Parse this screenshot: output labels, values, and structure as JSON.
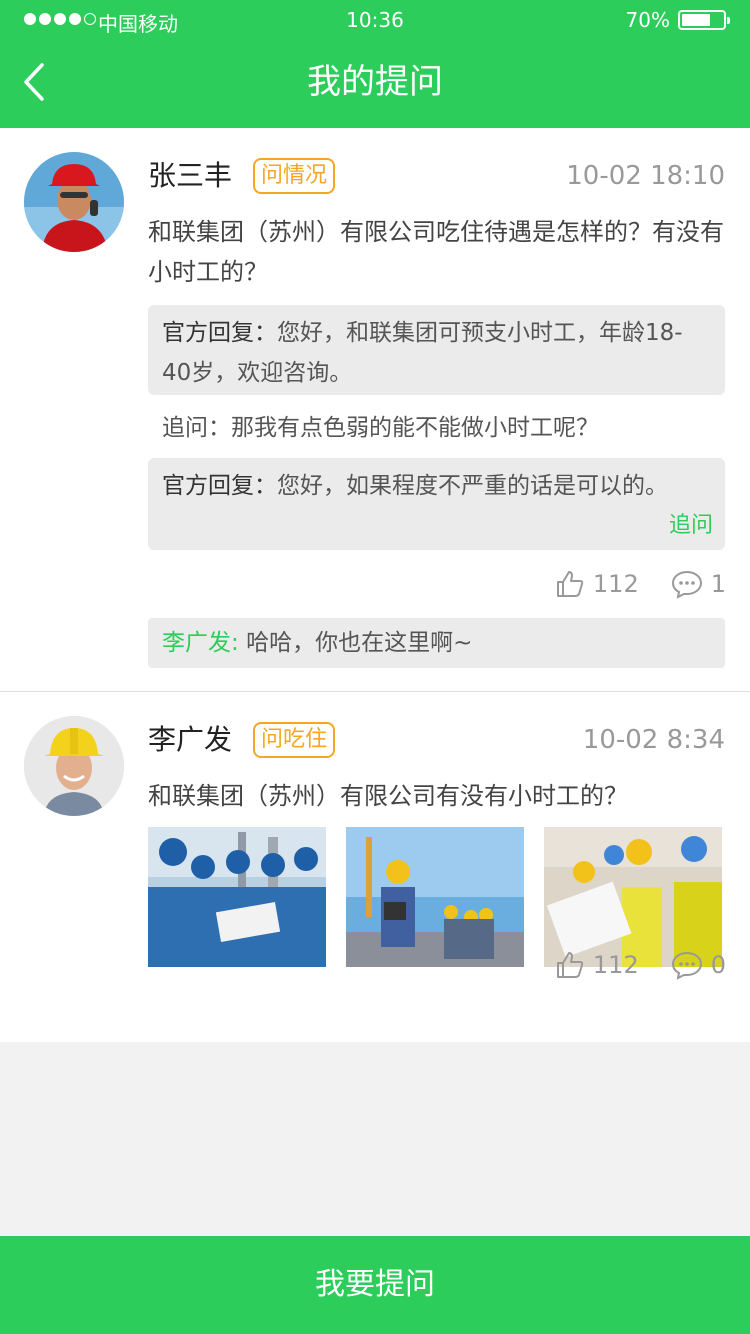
{
  "status_bar": {
    "carrier": "中国移动",
    "time": "10:36",
    "battery": "70%",
    "battery_level": 0.7
  },
  "nav": {
    "title": "我的提问",
    "back_icon": "chevron-left-icon"
  },
  "colors": {
    "brand": "#2ccd5a",
    "tag": "#f5a623"
  },
  "posts": [
    {
      "user": "张三丰",
      "tag": "问情况",
      "time": "10-02 18:10",
      "question": "和联集团（苏州）有限公司吃住待遇是怎样的？有没有小时工的？",
      "reply1_label": "官方回复：",
      "reply1_text": "您好，和联集团可预支小时工，年龄18-40岁，欢迎咨询。",
      "followup": "追问：那我有点色弱的能不能做小时工呢？",
      "reply2_label": "官方回复：",
      "reply2_text": "您好，如果程度不严重的话是可以的。",
      "followup_link": "追问",
      "likes": "112",
      "comments": "1",
      "comment_user": "李广发:",
      "comment_text": "哈哈，你也在这里啊~"
    },
    {
      "user": "李广发",
      "tag": "问吃住",
      "time": "10-02 8:34",
      "question": "和联集团（苏州）有限公司有没有小时工的？",
      "likes": "112",
      "comments": "0"
    }
  ],
  "footer": {
    "ask_button": "我要提问"
  }
}
